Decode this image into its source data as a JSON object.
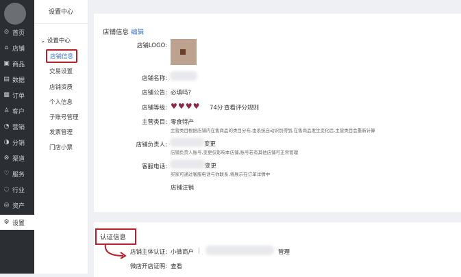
{
  "sidebar": {
    "items": [
      {
        "label": "首页",
        "icon": "home-icon",
        "glyph": "⊙"
      },
      {
        "label": "店铺",
        "icon": "store-icon",
        "glyph": "⌂"
      },
      {
        "label": "商品",
        "icon": "goods-icon",
        "glyph": "▣"
      },
      {
        "label": "数据",
        "icon": "chart-icon",
        "glyph": "▤"
      },
      {
        "label": "订单",
        "icon": "order-icon",
        "glyph": "▦"
      },
      {
        "label": "客户",
        "icon": "user-icon",
        "glyph": "♙"
      },
      {
        "label": "营销",
        "icon": "megaphone-icon",
        "glyph": "◔"
      },
      {
        "label": "分销",
        "icon": "share-icon",
        "glyph": "◑"
      },
      {
        "label": "渠道",
        "icon": "channel-icon",
        "glyph": "⊗"
      },
      {
        "label": "服务",
        "icon": "heart-icon",
        "glyph": "♡"
      },
      {
        "label": "行业",
        "icon": "industry-icon",
        "glyph": "◌"
      },
      {
        "label": "资产",
        "icon": "asset-icon",
        "glyph": "◎"
      },
      {
        "label": "设置",
        "icon": "gear-icon",
        "glyph": "⚙"
      }
    ]
  },
  "subnav": {
    "title": "设置中心",
    "group": "设置中心",
    "items": [
      "店铺信息",
      "交易设置",
      "店铺资质",
      "个人信息",
      "子账号管理",
      "发票管理",
      "门店小票"
    ]
  },
  "store_info": {
    "title": "店铺信息",
    "edit": "编辑",
    "logo_label": "店铺LOGO:",
    "name_label": "店铺名称:",
    "notice_label": "店铺公告:",
    "notice_value": "必填吗?",
    "level_label": "店铺等级:",
    "level_hearts": "♥♥♥♥",
    "level_score": "74分",
    "level_link": "查看评分规则",
    "category_label": "主营类目:",
    "category_value": "零食特产",
    "category_note": "主营类目根据店铺内在售商品的类目分布,由系统自动识别得到,在售商品发生变化后,主营类目会重新计算",
    "owner_label": "店铺负责人:",
    "owner_change": "变更",
    "owner_note": "店铺负责人账号,变更仅影响本店铺,账号若有其他店铺可正常管理",
    "service_label": "客服电话:",
    "service_change": "变更",
    "service_note": "买家可通过客服电话与你联系,将展示在订单详情中",
    "close_link": "店铺注销"
  },
  "cert": {
    "title": "认证信息",
    "subject_label": "店铺主体认证:",
    "subject_value": "小微商户",
    "subject_sep": "|",
    "manage": "管理",
    "proof_label": "微店开店证明:",
    "proof_link": "查看"
  }
}
